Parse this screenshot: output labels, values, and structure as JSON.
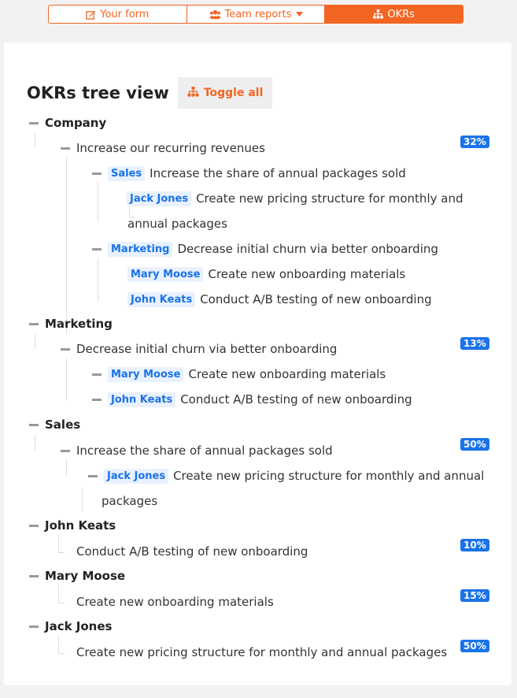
{
  "nav": {
    "tabs": [
      {
        "label": "Your form",
        "icon": "edit-icon"
      },
      {
        "label": "Team reports",
        "icon": "users-icon"
      },
      {
        "label": "OKRs",
        "icon": "sitemap-icon"
      }
    ]
  },
  "page": {
    "title": "OKRs tree view",
    "toggle_label": "Toggle all"
  },
  "colors": {
    "accent": "#f26522",
    "badge": "#1a73e8",
    "owner_bg": "#e8f1fd"
  },
  "tree": {
    "company": {
      "label": "Company",
      "objective": "Increase our recurring revenues",
      "percent": "32%",
      "sales": {
        "owner": "Sales",
        "text": "Increase the share of annual packages sold",
        "kr": {
          "owner": "Jack Jones",
          "text": "Create new pricing structure for monthly and",
          "text2": "annual packages"
        }
      },
      "marketing": {
        "owner": "Marketing",
        "text": "Decrease initial churn via better onboarding",
        "kr1": {
          "owner": "Mary Moose",
          "text": "Create new onboarding materials"
        },
        "kr2": {
          "owner": "John Keats",
          "text": "Conduct A/B testing of new onboarding"
        }
      }
    },
    "marketing": {
      "label": "Marketing",
      "objective": "Decrease initial churn via better onboarding",
      "percent": "13%",
      "kr1": {
        "owner": "Mary Moose",
        "text": "Create new onboarding materials"
      },
      "kr2": {
        "owner": "John Keats",
        "text": "Conduct A/B testing of new onboarding"
      }
    },
    "sales": {
      "label": "Sales",
      "objective": "Increase the share of annual packages sold",
      "percent": "50%",
      "kr": {
        "owner": "Jack Jones",
        "text": "Create new pricing structure for monthly and annual",
        "text2": "packages"
      }
    },
    "john": {
      "label": "John Keats",
      "objective": "Conduct A/B testing of new onboarding",
      "percent": "10%"
    },
    "mary": {
      "label": "Mary Moose",
      "objective": "Create new onboarding materials",
      "percent": "15%"
    },
    "jack": {
      "label": "Jack Jones",
      "objective": "Create new pricing structure for monthly and annual packages",
      "percent": "50%"
    }
  }
}
